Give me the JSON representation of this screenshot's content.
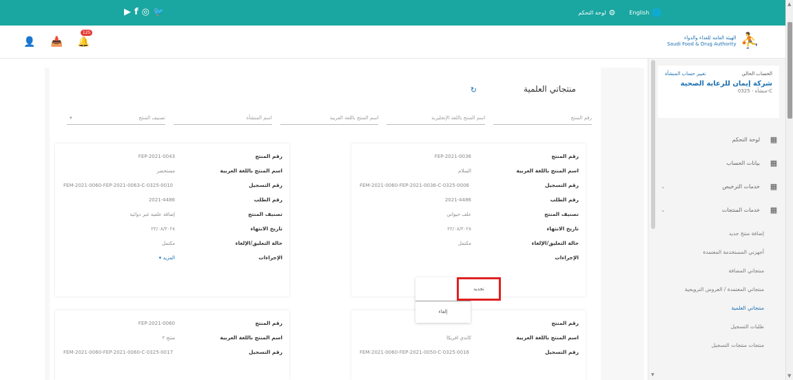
{
  "topbar": {
    "social": [
      "▶",
      "f",
      "◎",
      "🐦"
    ],
    "language": "English",
    "settings_label": "لوحة التحكم"
  },
  "header": {
    "notification_count": "125",
    "logo_line1": "الهيئة العامة للغذاء والدواء",
    "logo_line2": "Saudi Food & Drug Authority"
  },
  "sidebar": {
    "account_label": "الحساب الحالي",
    "switch_link": "تغيير حساب المنشأة",
    "org_name": "شركة إيمان للرعاية الصحية",
    "org_sub": "منشأة - 0325-C",
    "menu": [
      {
        "label": "لوحة التحكم",
        "chevron": ""
      },
      {
        "label": "بيانات الحساب",
        "chevron": ""
      },
      {
        "label": "خدمات الترخيص",
        "chevron": "⌄"
      },
      {
        "label": "خدمات المنتجات",
        "chevron": "⌄"
      }
    ],
    "submenu": [
      {
        "label": "إضافة منتج جديد",
        "active": false
      },
      {
        "label": "أجهزتي المستخدمة المعتمدة",
        "active": false
      },
      {
        "label": "منتجاتي المضافة",
        "active": false
      },
      {
        "label": "منتجاتي المعتمدة / العروض الترويجية",
        "active": false
      },
      {
        "label": "منتجاتي العلمية",
        "active": true
      },
      {
        "label": "طلبات التسجيل",
        "active": false
      },
      {
        "label": "منتجات منتجات التسجيل",
        "active": false
      }
    ]
  },
  "page": {
    "title": "منتجاتي العلمية",
    "refresh_icon": "↻"
  },
  "filters": [
    {
      "placeholder": "رقم المنتج",
      "caret": ""
    },
    {
      "placeholder": "اسم المنتج باللغة الإنجليزية",
      "caret": ""
    },
    {
      "placeholder": "اسم المنتج باللغة العربية",
      "caret": ""
    },
    {
      "placeholder": "اسم المنشأة",
      "caret": ""
    },
    {
      "placeholder": "تصنيف المنتج",
      "caret": "▾"
    }
  ],
  "labels": {
    "product_no": "رقم المنتج",
    "name_ar": "اسم المنتج باللغة العربية",
    "registration_no": "رقم التسجيل",
    "request_no": "رقم الطلب",
    "classification": "تصنيف المنتج",
    "expiry_date": "تاريخ الانتهاء",
    "status": "حالة التعليق/الإلغاء",
    "actions": "الإجراءات"
  },
  "cards": [
    {
      "product_no": "FEP-2021-0036",
      "name_ar": "السلام",
      "registration_no": "FEM-2021-0060-FEP-2021-0036-C-0325-0006",
      "request_no": "2021-4486",
      "classification": "علف حيواني",
      "expiry_date": "٢٢/٠٨/٢٠٢٨",
      "status": "مكتمل",
      "actions": ""
    },
    {
      "product_no": "FEP-2021-0043",
      "name_ar": "مستحضر",
      "registration_no": "FEM-2021-0060-FEP-2021-0063-C-0325-0010",
      "request_no": "2021-4486",
      "classification": "إضافة علفية غير دوائية",
      "expiry_date": "٢٢/٠٨/٢٠٢٨",
      "status": "مكتمل",
      "actions": "▾ المزيد"
    },
    {
      "product_no": "",
      "name_ar": "كاندي افريكا",
      "registration_no": "FEM-2021-0060-FEP-2021-0050-C-0325-0016"
    },
    {
      "product_no": "FEP-2021-0060",
      "name_ar": "منتج ٢",
      "registration_no": "FEM-2021-0060-FEP-2021-0060-C-0325-0017"
    }
  ],
  "dropdown": {
    "renew": "تجديد",
    "cancel": "إلغاء"
  }
}
